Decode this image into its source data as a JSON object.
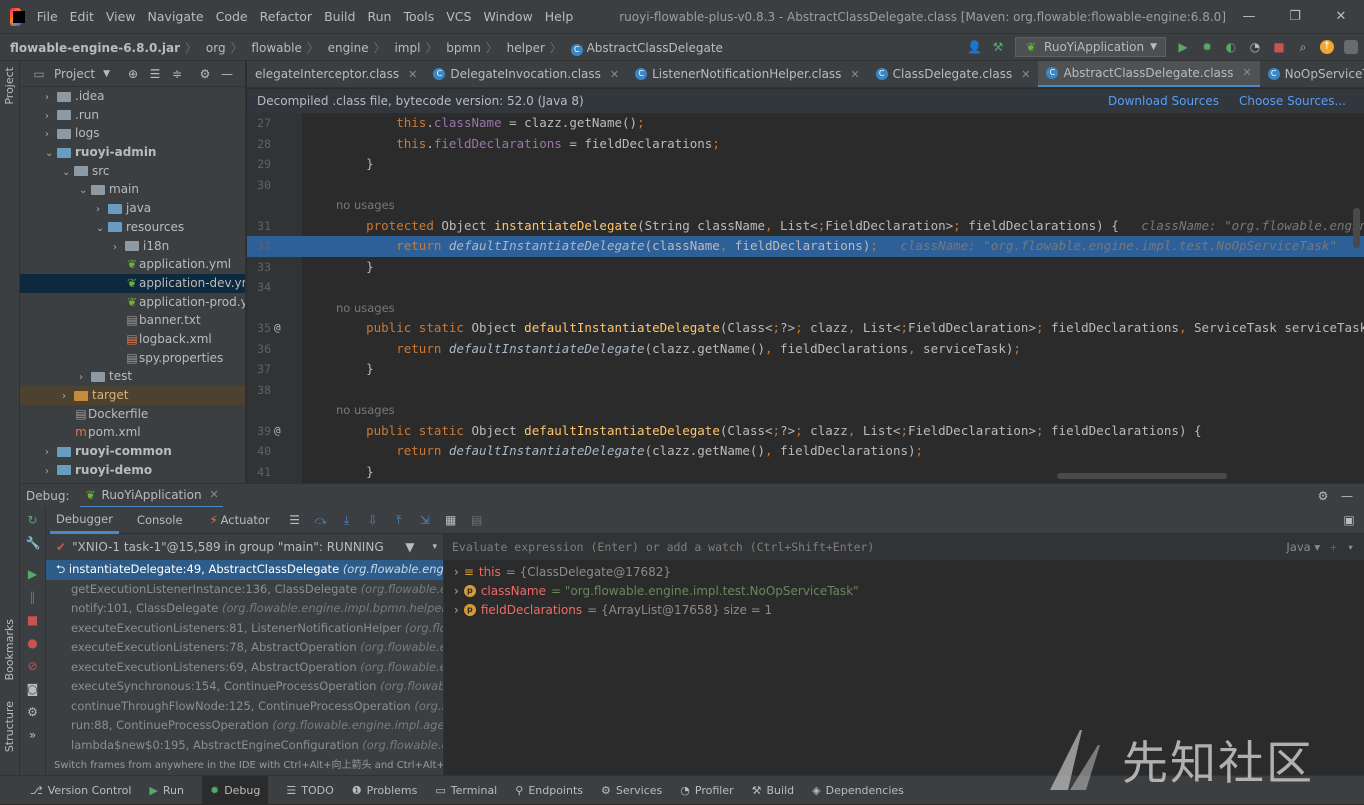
{
  "menu": [
    "File",
    "Edit",
    "View",
    "Navigate",
    "Code",
    "Refactor",
    "Build",
    "Run",
    "Tools",
    "VCS",
    "Window",
    "Help"
  ],
  "window_title": "ruoyi-flowable-plus-v0.8.3 - AbstractClassDelegate.class [Maven: org.flowable:flowable-engine:6.8.0]",
  "breadcrumb": [
    "flowable-engine-6.8.0.jar",
    "org",
    "flowable",
    "engine",
    "impl",
    "bpmn",
    "helper",
    "AbstractClassDelegate"
  ],
  "run_config": "RuoYiApplication",
  "project_panel": {
    "title": "Project",
    "items": [
      {
        "label": ".idea",
        "level": 1,
        "type": "folder"
      },
      {
        "label": ".run",
        "level": 1,
        "type": "folder"
      },
      {
        "label": "logs",
        "level": 1,
        "type": "folder"
      },
      {
        "label": "ruoyi-admin",
        "level": 1,
        "type": "module"
      },
      {
        "label": "src",
        "level": 2,
        "type": "folder"
      },
      {
        "label": "main",
        "level": 3,
        "type": "folder"
      },
      {
        "label": "java",
        "level": 4,
        "type": "src"
      },
      {
        "label": "resources",
        "level": 4,
        "type": "res"
      },
      {
        "label": "i18n",
        "level": 5,
        "type": "folder"
      },
      {
        "label": "application.yml",
        "level": 5,
        "type": "file"
      },
      {
        "label": "application-dev.yml",
        "level": 5,
        "type": "file"
      },
      {
        "label": "application-prod.y",
        "level": 5,
        "type": "file"
      },
      {
        "label": "banner.txt",
        "level": 5,
        "type": "file"
      },
      {
        "label": "logback.xml",
        "level": 5,
        "type": "file"
      },
      {
        "label": "spy.properties",
        "level": 5,
        "type": "file"
      },
      {
        "label": "test",
        "level": 3,
        "type": "folder"
      },
      {
        "label": "target",
        "level": 2,
        "type": "target"
      },
      {
        "label": "Dockerfile",
        "level": 2,
        "type": "file"
      },
      {
        "label": "pom.xml",
        "level": 2,
        "type": "file"
      },
      {
        "label": "ruoyi-common",
        "level": 1,
        "type": "module"
      },
      {
        "label": "ruoyi-demo",
        "level": 1,
        "type": "module"
      }
    ]
  },
  "tabs": [
    "elegateInterceptor.class",
    "DelegateInvocation.class",
    "ListenerNotificationHelper.class",
    "ClassDelegate.class",
    "AbstractClassDelegate.class",
    "NoOpServiceTask.class"
  ],
  "active_tab": "AbstractClassDelegate.class",
  "banner": {
    "text": "Decompiled .class file, bytecode version: 52.0 (Java 8)",
    "download": "Download Sources",
    "choose": "Choose Sources..."
  },
  "code_lines": [
    {
      "n": "27",
      "t": "        this.className = clazz.getName();"
    },
    {
      "n": "28",
      "t": "        this.fieldDeclarations = fieldDeclarations;"
    },
    {
      "n": "29",
      "t": "    }"
    },
    {
      "n": "30",
      "t": ""
    },
    {
      "n": "",
      "t": "no usages"
    },
    {
      "n": "31",
      "t": "    protected Object instantiateDelegate(String className, List<FieldDeclaration> fieldDeclarations) {   className: \"org.flowable.engine.impl"
    },
    {
      "n": "32",
      "t": "        return defaultInstantiateDelegate(className, fieldDeclarations);   className: \"org.flowable.engine.impl.test.NoOpServiceTask\"     fiel"
    },
    {
      "n": "33",
      "t": "    }"
    },
    {
      "n": "34",
      "t": ""
    },
    {
      "n": "",
      "t": "no usages"
    },
    {
      "n": "35",
      "t": "    public static Object defaultInstantiateDelegate(Class<?> clazz, List<FieldDeclaration> fieldDeclarations, ServiceTask serviceTask) {"
    },
    {
      "n": "36",
      "t": "        return defaultInstantiateDelegate(clazz.getName(), fieldDeclarations, serviceTask);"
    },
    {
      "n": "37",
      "t": "    }"
    },
    {
      "n": "38",
      "t": ""
    },
    {
      "n": "",
      "t": "no usages"
    },
    {
      "n": "39",
      "t": "    public static Object defaultInstantiateDelegate(Class<?> clazz, List<FieldDeclaration> fieldDeclarations) {"
    },
    {
      "n": "40",
      "t": "        return defaultInstantiateDelegate(clazz.getName(), fieldDeclarations);"
    },
    {
      "n": "41",
      "t": "    }"
    }
  ],
  "debug": {
    "label": "Debug:",
    "session": "RuoYiApplication",
    "tabs": [
      "Debugger",
      "Console",
      "Actuator"
    ],
    "thread": "\"XNIO-1 task-1\"@15,589 in group \"main\": RUNNING",
    "frames": [
      {
        "m": "instantiateDelegate:49, AbstractClassDelegate ",
        "p": "(org.flowable.engine.i"
      },
      {
        "m": "getExecutionListenerInstance:136, ClassDelegate ",
        "p": "(org.flowable.engi"
      },
      {
        "m": "notify:101, ClassDelegate ",
        "p": "(org.flowable.engine.impl.bpmn.helper)"
      },
      {
        "m": "executeExecutionListeners:81, ListenerNotificationHelper ",
        "p": "(org.flowa"
      },
      {
        "m": "executeExecutionListeners:78, AbstractOperation ",
        "p": "(org.flowable.engi"
      },
      {
        "m": "executeExecutionListeners:69, AbstractOperation ",
        "p": "(org.flowable.engi"
      },
      {
        "m": "executeSynchronous:154, ContinueProcessOperation ",
        "p": "(org.flowable.e"
      },
      {
        "m": "continueThroughFlowNode:125, ContinueProcessOperation ",
        "p": "(org.flo"
      },
      {
        "m": "run:88, ContinueProcessOperation ",
        "p": "(org.flowable.engine.impl.agend"
      },
      {
        "m": "lambda$new$0:195, AbstractEngineConfiguration ",
        "p": "(org.flowable.com"
      }
    ],
    "hint": "Switch frames from anywhere in the IDE with Ctrl+Alt+向上箭头 and Ctrl+Alt+向",
    "eval_placeholder": "Evaluate expression (Enter) or add a watch (Ctrl+Shift+Enter)",
    "lang": "Java",
    "vars": [
      {
        "name": "this",
        "val": "= {ClassDelegate@17682}",
        "kind": "obj"
      },
      {
        "name": "className",
        "val": "= \"org.flowable.engine.impl.test.NoOpServiceTask\"",
        "kind": "str"
      },
      {
        "name": "fieldDeclarations",
        "val": "= {ArrayList@17658}  size = 1",
        "kind": "obj"
      }
    ]
  },
  "statusbar": [
    "Version Control",
    "Run",
    "Debug",
    "TODO",
    "Problems",
    "Terminal",
    "Endpoints",
    "Services",
    "Profiler",
    "Build",
    "Dependencies"
  ],
  "side_labels": {
    "project": "Project",
    "bookmarks": "Bookmarks",
    "structure": "Structure"
  },
  "watermark": "先知社区"
}
